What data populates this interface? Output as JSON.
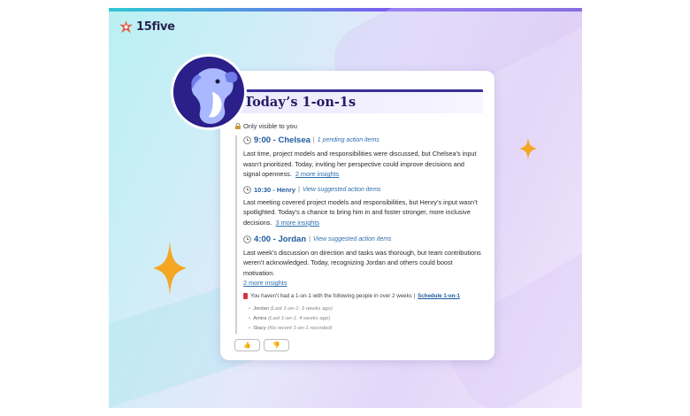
{
  "brand": {
    "name": "15five",
    "accent": "#e9573f"
  },
  "card": {
    "title": "Today’s 1-on-1s",
    "visibility": "Only visible to you",
    "meetings": [
      {
        "time_name": "9:00 - Chelsea",
        "action": "1 pending action items",
        "body": "Last time, project models and responsibilities were discussed, but Chelsea’s input wasn’t prioritized. Today, inviting her perspective could improve decisions and signal openness.",
        "insights": "2 more insights"
      },
      {
        "time_name": "10:30 - Henry",
        "action": "View suggested action items",
        "body": "Last meeting covered project models and responsibilities, but Henry’s input wasn’t spotlighted. Today’s a chance to bring him in and foster stronger, more inclusive decisions.",
        "insights": "3 more insights"
      },
      {
        "time_name": "4:00 - Jordan",
        "action": "View suggested action items",
        "body": "Last week’s discussion on direction and tasks was thorough, but team contributions weren’t acknowledged. Today, recognizing Jordan and others could boost motivation.",
        "insights": "2 more insights"
      }
    ],
    "overdue": {
      "text": "You haven’t had a 1-on-1 with the following people in over 2 weeks |",
      "link": "Schedule 1-on-1",
      "people": [
        {
          "name": "Jordan",
          "note": "(Last 1-on-1: 3 weeks ago)"
        },
        {
          "name": "Amira",
          "note": "(Last 1-on-1: 4 weeks ago)"
        },
        {
          "name": "Stacy",
          "note": "(No recent 1-on-1 recorded)"
        }
      ]
    },
    "feedback": {
      "up": "👍",
      "down": "👎"
    }
  }
}
